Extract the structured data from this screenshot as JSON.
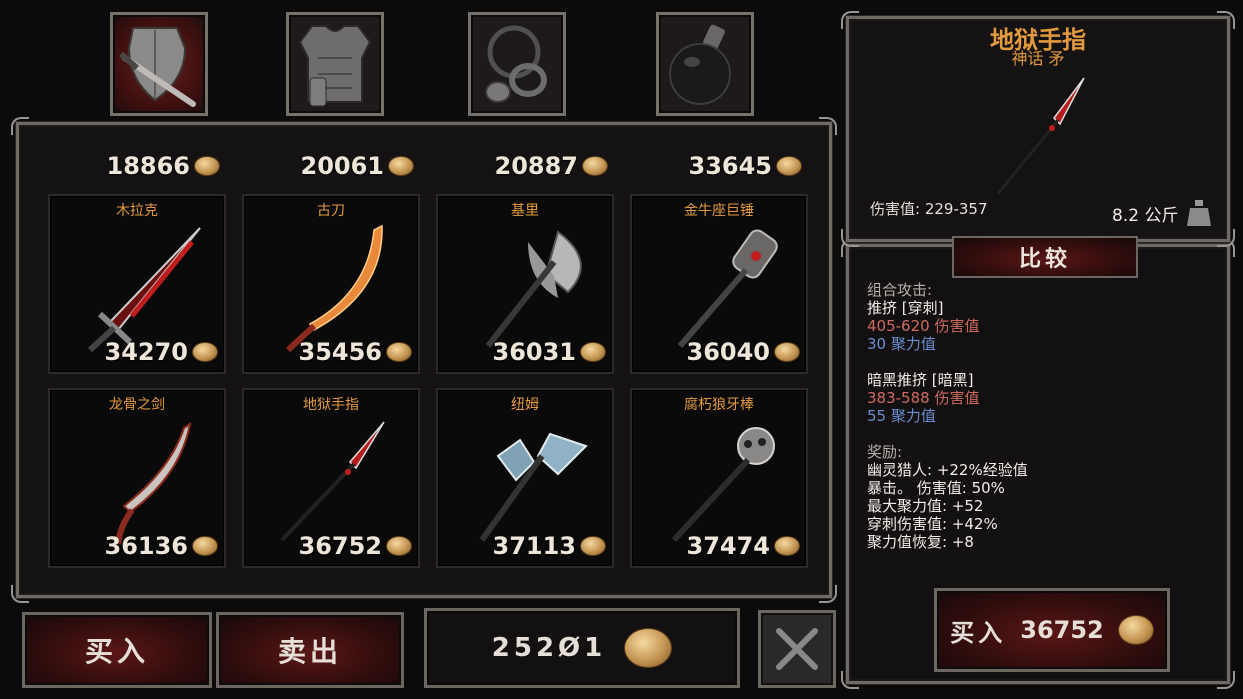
{
  "tabs": [
    {
      "name": "weapons",
      "icon": "sword-shield-icon",
      "active": true
    },
    {
      "name": "armor",
      "icon": "armor-icon",
      "active": false
    },
    {
      "name": "rings",
      "icon": "rings-icon",
      "active": false
    },
    {
      "name": "potions",
      "icon": "potion-icon",
      "active": false
    }
  ],
  "top_row": [
    "18866",
    "20061",
    "20887",
    "33645"
  ],
  "items": [
    {
      "name": "木拉克",
      "price": "34270"
    },
    {
      "name": "古刀",
      "price": "35456"
    },
    {
      "name": "基里",
      "price": "36031"
    },
    {
      "name": "金牛座巨锤",
      "price": "36040"
    },
    {
      "name": "龙骨之剑",
      "price": "36136"
    },
    {
      "name": "地狱手指",
      "price": "36752"
    },
    {
      "name": "纽姆",
      "price": "37113"
    },
    {
      "name": "腐朽狼牙棒",
      "price": "37474"
    }
  ],
  "bottom": {
    "buy_label": "买入",
    "sell_label": "卖出",
    "gold": "252Ø1"
  },
  "detail": {
    "title": "地狱手指",
    "subtitle": "神话 矛",
    "damage": "伤害值: 229-357",
    "weight": "8.2 公斤",
    "compare_label": "比较",
    "combo_heading": "组合攻击:",
    "attack1_name": "推挤 [穿刺]",
    "attack1_damage": "405-620 伤害值",
    "attack1_focus": "30 聚力值",
    "attack2_name": "暗黑推挤 [暗黑]",
    "attack2_damage": "383-588 伤害值",
    "attack2_focus": "55 聚力值",
    "bonus_heading": "奖励:",
    "bonuses": [
      "幽灵猎人:  +22%经验值",
      "暴击。 伤害值:  50%",
      "最大聚力值:  +52",
      "穿刺伤害值:  +42%",
      "聚力值恢复:  +8"
    ],
    "buy_label": "买入",
    "buy_price": "36752"
  },
  "colors": {
    "accent_orange": "#e39a3e",
    "damage_red": "#d06a5f",
    "focus_blue": "#6b8ed4",
    "button_red": "#5b1616"
  }
}
